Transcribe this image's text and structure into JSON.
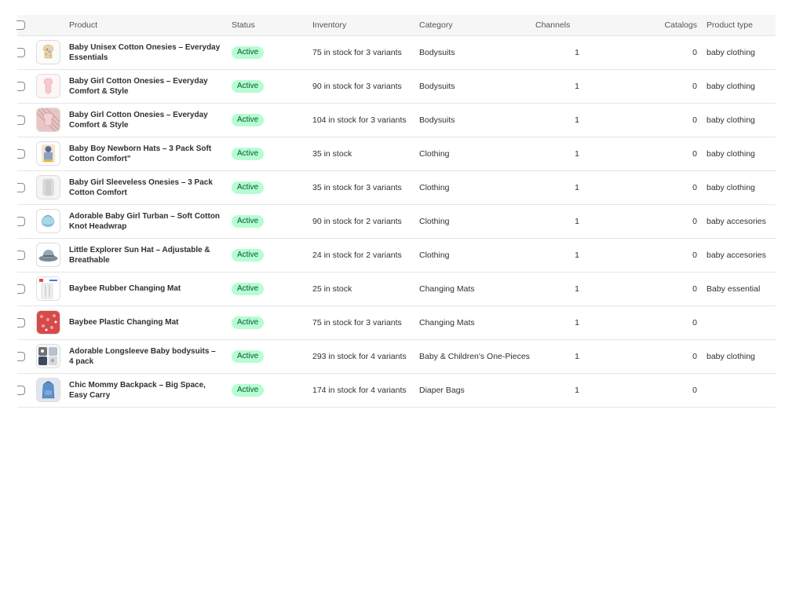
{
  "table": {
    "headers": {
      "product": "Product",
      "status": "Status",
      "inventory": "Inventory",
      "category": "Category",
      "channels": "Channels",
      "catalogs": "Catalogs",
      "product_type": "Product type"
    },
    "rows": [
      {
        "name": "Baby Unisex Cotton Onesies – Everyday Essentials",
        "status": "Active",
        "inventory": "75 in stock for 3 variants",
        "category": "Bodysuits",
        "channels": "1",
        "catalogs": "0",
        "product_type": "baby clothing",
        "thumb": "onesie-multicolor"
      },
      {
        "name": "Baby Girl Cotton Onesies – Everyday Comfort & Style",
        "status": "Active",
        "inventory": "90 in stock for 3 variants",
        "category": "Bodysuits",
        "channels": "1",
        "catalogs": "0",
        "product_type": "baby clothing",
        "thumb": "onesie-pink"
      },
      {
        "name": "Baby Girl Cotton Onesies – Everyday Comfort & Style",
        "status": "Active",
        "inventory": "104 in stock for 3 variants",
        "category": "Bodysuits",
        "channels": "1",
        "catalogs": "0",
        "product_type": "baby clothing",
        "thumb": "onesie-pink-stack"
      },
      {
        "name": "Baby Boy Newborn Hats – 3 Pack Soft Cotton Comfort\"",
        "status": "Active",
        "inventory": "35 in stock",
        "category": "Clothing",
        "channels": "1",
        "catalogs": "0",
        "product_type": "baby clothing",
        "thumb": "hats-pack"
      },
      {
        "name": "Baby Girl Sleeveless Onesies – 3 Pack Cotton Comfort",
        "status": "Active",
        "inventory": "35 in stock for 3 variants",
        "category": "Clothing",
        "channels": "1",
        "catalogs": "0",
        "product_type": "baby clothing",
        "thumb": "sleeveless-pack"
      },
      {
        "name": "Adorable Baby Girl Turban – Soft Cotton Knot Headwrap",
        "status": "Active",
        "inventory": "90 in stock for 2 variants",
        "category": "Clothing",
        "channels": "1",
        "catalogs": "0",
        "product_type": "baby accesories",
        "thumb": "turban"
      },
      {
        "name": "Little Explorer Sun Hat – Adjustable & Breathable",
        "status": "Active",
        "inventory": "24 in stock for 2 variants",
        "category": "Clothing",
        "channels": "1",
        "catalogs": "0",
        "product_type": "baby accesories",
        "thumb": "sun-hat"
      },
      {
        "name": "Baybee Rubber Changing Mat",
        "status": "Active",
        "inventory": "25 in stock",
        "category": "Changing Mats",
        "channels": "1",
        "catalogs": "0",
        "product_type": "Baby essential",
        "thumb": "rubber-mat"
      },
      {
        "name": "Baybee Plastic Changing Mat",
        "status": "Active",
        "inventory": "75 in stock for 3 variants",
        "category": "Changing Mats",
        "channels": "1",
        "catalogs": "0",
        "product_type": "",
        "thumb": "plastic-mat"
      },
      {
        "name": "Adorable Longsleeve Baby bodysuits – 4 pack",
        "status": "Active",
        "inventory": "293 in stock for 4 variants",
        "category": "Baby & Children's One-Pieces",
        "channels": "1",
        "catalogs": "0",
        "product_type": "baby clothing",
        "thumb": "longsleeve-pack"
      },
      {
        "name": "Chic Mommy Backpack – Big Space, Easy Carry",
        "status": "Active",
        "inventory": "174 in stock for 4 variants",
        "category": "Diaper Bags",
        "channels": "1",
        "catalogs": "0",
        "product_type": "",
        "thumb": "backpack"
      }
    ]
  },
  "colors": {
    "active_badge_bg": "#b4fed2",
    "active_badge_text": "#0c5132",
    "header_bg": "#f6f6f6",
    "row_border": "#e6e6e6"
  }
}
